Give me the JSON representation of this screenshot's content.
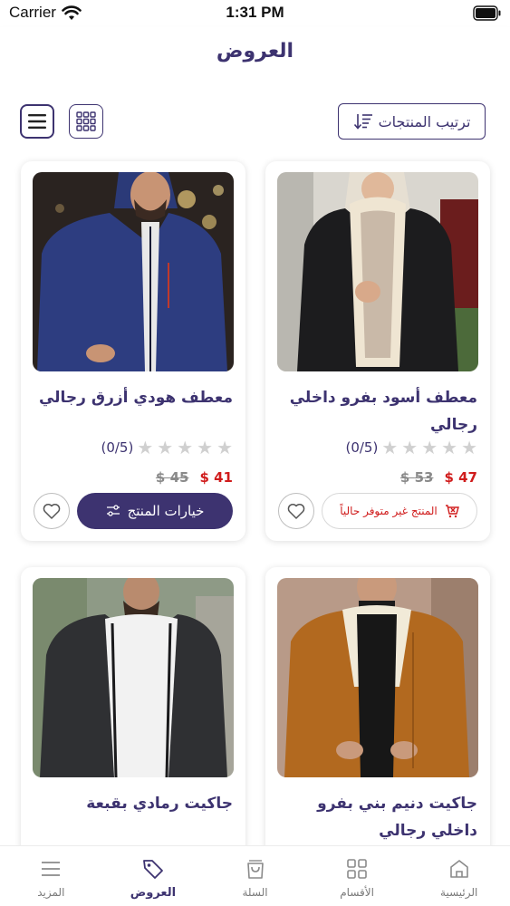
{
  "status_bar": {
    "carrier": "Carrier",
    "time": "1:31 PM"
  },
  "header": {
    "title": "العروض"
  },
  "toolbar": {
    "sort_label": "ترتيب المنتجات"
  },
  "products": [
    {
      "title": "معطف أسود بفرو داخلي رجالي",
      "rating_count": "(0/5)",
      "price_new": "47 $",
      "price_old": "53 $",
      "action_label": "المنتج غير متوفر حالياً",
      "available": false,
      "image": "black-fur-coat"
    },
    {
      "title": "معطف هودي أزرق رجالي",
      "rating_count": "(0/5)",
      "price_new": "41 $",
      "price_old": "45 $",
      "action_label": "خيارات المنتج",
      "available": true,
      "image": "blue-hooded-jacket"
    },
    {
      "title": "جاكيت دنيم بني بفرو داخلي رجالي",
      "image": "brown-fur-jacket"
    },
    {
      "title": "جاكيت رمادي بقبعة",
      "image": "grey-hooded-jacket"
    }
  ],
  "bottom_nav": {
    "items": [
      {
        "label": "الرئيسية",
        "icon": "home-icon",
        "active": false
      },
      {
        "label": "الأقسام",
        "icon": "grid-icon",
        "active": false
      },
      {
        "label": "السلة",
        "icon": "bag-icon",
        "active": false
      },
      {
        "label": "العروض",
        "icon": "tag-icon",
        "active": true
      },
      {
        "label": "المزيد",
        "icon": "menu-icon",
        "active": false
      }
    ]
  },
  "colors": {
    "primary": "#3d3370",
    "sale_price": "#d01c1c",
    "star": "#d0d0d0"
  }
}
